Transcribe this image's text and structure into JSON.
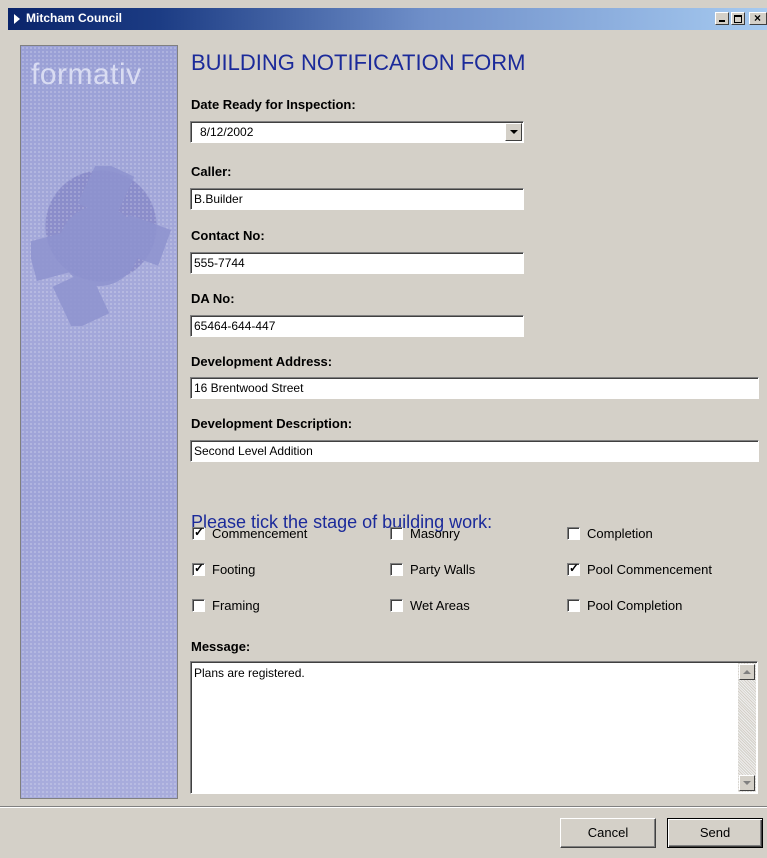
{
  "window": {
    "title": "Mitcham Council"
  },
  "sidebar": {
    "logo": "formativ"
  },
  "form": {
    "title": "BUILDING NOTIFICATION FORM",
    "date": {
      "label": "Date Ready for Inspection:",
      "value": "8/12/2002"
    },
    "caller": {
      "label": "Caller:",
      "value": "B.Builder"
    },
    "contact": {
      "label": "Contact No:",
      "value": "555-7744"
    },
    "da": {
      "label": "DA No:",
      "value": "65464-644-447"
    },
    "address": {
      "label": "Development Address:",
      "value": "16 Brentwood Street"
    },
    "description": {
      "label": "Development Description:",
      "value": "Second Level Addition"
    }
  },
  "stages": {
    "heading": "Please tick the stage of building work:",
    "items": [
      {
        "label": "Commencement",
        "checked": true
      },
      {
        "label": "Masonry",
        "checked": false
      },
      {
        "label": "Completion",
        "checked": false
      },
      {
        "label": "Footing",
        "checked": true
      },
      {
        "label": "Party Walls",
        "checked": false
      },
      {
        "label": "Pool Commencement",
        "checked": true
      },
      {
        "label": "Framing",
        "checked": false
      },
      {
        "label": "Wet Areas",
        "checked": false
      },
      {
        "label": "Pool Completion",
        "checked": false
      }
    ]
  },
  "message": {
    "label": "Message:",
    "value": "Plans are registered."
  },
  "buttons": {
    "cancel": "Cancel",
    "send": "Send"
  },
  "colors": {
    "accent_text": "#1b2a9a",
    "title_bar": "#0a246a",
    "sidebar": "#9ea3d8"
  }
}
